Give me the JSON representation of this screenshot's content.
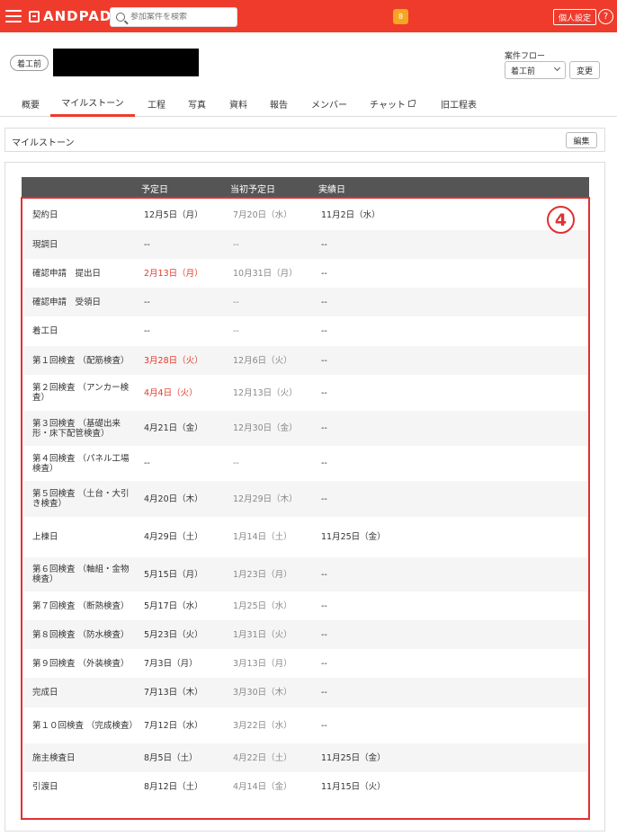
{
  "header": {
    "logo_text": "ANDPAD",
    "search_placeholder": "参加案件を検索",
    "notification_count": "8",
    "personal_settings_label": "個人設定",
    "help_label": "?",
    "accent_color": "#ef3b2c"
  },
  "project": {
    "status_badge": "着工前",
    "flow_label": "案件フロー",
    "flow_value": "着工前",
    "change_button": "変更"
  },
  "tabs": [
    {
      "label": "概要"
    },
    {
      "label": "マイルストーン"
    },
    {
      "label": "工程"
    },
    {
      "label": "写真"
    },
    {
      "label": "資料"
    },
    {
      "label": "報告"
    },
    {
      "label": "メンバー"
    },
    {
      "label": "チャット"
    },
    {
      "label": "旧工程表"
    }
  ],
  "section": {
    "title": "マイルストーン",
    "edit_button": "編集"
  },
  "table": {
    "headers": [
      "予定日",
      "当初予定日",
      "実績日"
    ],
    "rows": [
      {
        "name": "契約日",
        "planned": "12月5日（月）",
        "original": "7月20日（水）",
        "actual": "11月2日（水）",
        "planned_highlight": false
      },
      {
        "name": "現調日",
        "planned": "--",
        "original": "--",
        "actual": "--",
        "planned_highlight": false
      },
      {
        "name": "確認申請　提出日",
        "planned": "2月13日（月）",
        "original": "10月31日（月）",
        "actual": "--",
        "planned_highlight": true
      },
      {
        "name": "確認申請　受領日",
        "planned": "--",
        "original": "--",
        "actual": "--",
        "planned_highlight": false
      },
      {
        "name": "着工日",
        "planned": "--",
        "original": "--",
        "actual": "--",
        "planned_highlight": false
      },
      {
        "name": "第１回検査 （配筋検査）",
        "planned": "3月28日（火）",
        "original": "12月6日（火）",
        "actual": "--",
        "planned_highlight": true
      },
      {
        "name": "第２回検査 （アンカー検査）",
        "planned": "4月4日（火）",
        "original": "12月13日（火）",
        "actual": "--",
        "planned_highlight": true
      },
      {
        "name": "第３回検査 （基礎出来形・床下配管検査）",
        "planned": "4月21日（金）",
        "original": "12月30日（金）",
        "actual": "--",
        "planned_highlight": false
      },
      {
        "name": "第４回検査 （パネル工場検査）",
        "planned": "--",
        "original": "--",
        "actual": "--",
        "planned_highlight": false
      },
      {
        "name": "第５回検査 （土台・大引き検査）",
        "planned": "4月20日（木）",
        "original": "12月29日（木）",
        "actual": "--",
        "planned_highlight": false
      },
      {
        "name": "上棟日",
        "planned": "4月29日（土）",
        "original": "1月14日（土）",
        "actual": "11月25日（金）",
        "planned_highlight": false
      },
      {
        "name": "第６回検査 （軸組・金物検査）",
        "planned": "5月15日（月）",
        "original": "1月23日（月）",
        "actual": "--",
        "planned_highlight": false
      },
      {
        "name": "第７回検査 （断熱検査）",
        "planned": "5月17日（水）",
        "original": "1月25日（水）",
        "actual": "--",
        "planned_highlight": false
      },
      {
        "name": "第８回検査 （防水検査）",
        "planned": "5月23日（火）",
        "original": "1月31日（火）",
        "actual": "--",
        "planned_highlight": false
      },
      {
        "name": "第９回検査 （外装検査）",
        "planned": "7月3日（月）",
        "original": "3月13日（月）",
        "actual": "--",
        "planned_highlight": false
      },
      {
        "name": "完成日",
        "planned": "7月13日（木）",
        "original": "3月30日（木）",
        "actual": "--",
        "planned_highlight": false
      },
      {
        "name": "第１０回検査 （完成検査）",
        "planned": "7月12日（水）",
        "original": "3月22日（水）",
        "actual": "--",
        "planned_highlight": false
      },
      {
        "name": "施主検査日",
        "planned": "8月5日（土）",
        "original": "4月22日（土）",
        "actual": "11月25日（金）",
        "planned_highlight": false
      },
      {
        "name": "引渡日",
        "planned": "8月12日（土）",
        "original": "4月14日（金）",
        "actual": "11月15日（火）",
        "planned_highlight": false
      }
    ]
  },
  "annotation": {
    "marker_label": "4",
    "color": "#e23030"
  }
}
